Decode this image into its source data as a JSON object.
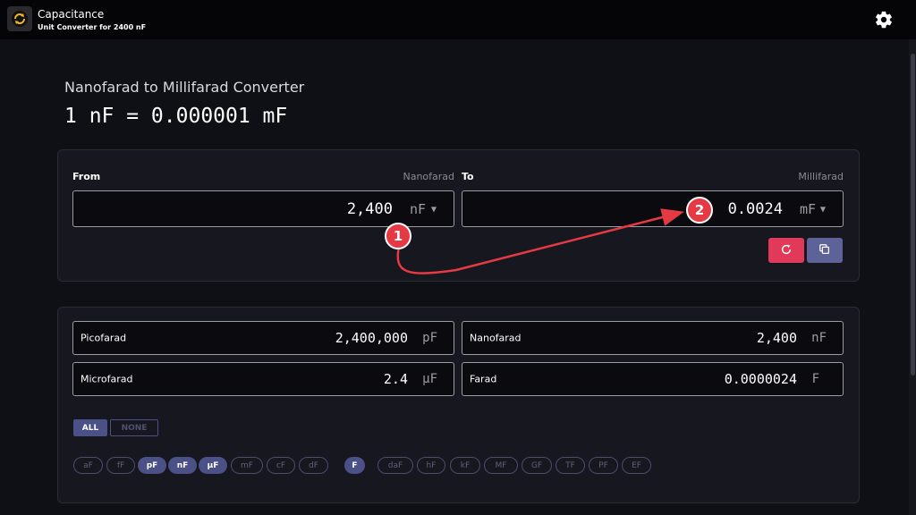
{
  "app": {
    "title": "Capacitance",
    "subtitle": "Unit Converter for 2400 nF"
  },
  "converter": {
    "heading": "Nanofarad to Millifarad Converter",
    "formula": "1 nF = 0.000001 mF",
    "from": {
      "label": "From",
      "unit_name": "Nanofarad",
      "value": "2,400",
      "unit": "nF"
    },
    "to": {
      "label": "To",
      "unit_name": "Millifarad",
      "value": "0.0024",
      "unit": "mF"
    }
  },
  "annotations": {
    "step1": "1",
    "step2": "2",
    "arrow_color": "#e53a44"
  },
  "results": [
    {
      "name": "Picofarad",
      "value": "2,400,000",
      "unit": "pF"
    },
    {
      "name": "Nanofarad",
      "value": "2,400",
      "unit": "nF"
    },
    {
      "name": "Microfarad",
      "value": "2.4",
      "unit": "µF"
    },
    {
      "name": "Farad",
      "value": "0.0000024",
      "unit": "F"
    }
  ],
  "filters": {
    "all": "ALL",
    "none": "NONE",
    "chips": [
      {
        "label": "aF",
        "active": false
      },
      {
        "label": "fF",
        "active": false
      },
      {
        "label": "pF",
        "active": true
      },
      {
        "label": "nF",
        "active": true
      },
      {
        "label": "µF",
        "active": true
      },
      {
        "label": "mF",
        "active": false
      },
      {
        "label": "cF",
        "active": false
      },
      {
        "label": "dF",
        "active": false
      },
      {
        "label": "F",
        "active": true
      },
      {
        "label": "daF",
        "active": false
      },
      {
        "label": "hF",
        "active": false
      },
      {
        "label": "kF",
        "active": false
      },
      {
        "label": "MF",
        "active": false
      },
      {
        "label": "GF",
        "active": false
      },
      {
        "label": "TF",
        "active": false
      },
      {
        "label": "PF",
        "active": false
      },
      {
        "label": "EF",
        "active": false
      }
    ]
  },
  "colors": {
    "accent": "#4b5087",
    "reset_button": "#e0395a",
    "copy_button": "#5d6399",
    "background": "#0f1016"
  },
  "icons": {
    "logo": "refresh-logo-icon",
    "settings": "gear-icon",
    "reset": "refresh-icon",
    "copy": "copy-icon",
    "dropdown": "caret-down-icon"
  }
}
